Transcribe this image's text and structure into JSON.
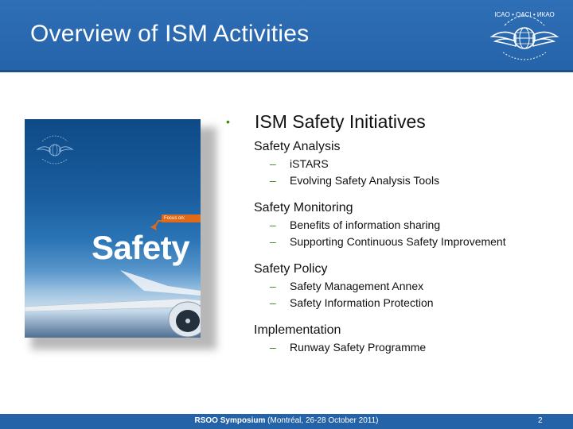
{
  "header": {
    "title": "Overview of ISM Activities",
    "logo_icon": "icao-emblem-icon",
    "logo_text": "ICAO • OACI • ИКАО"
  },
  "book_cover": {
    "tag": "Focus on:",
    "title": "Safety",
    "seal_icon": "icao-seal-icon",
    "image_icon": "airplane-icon"
  },
  "content": {
    "heading": "ISM Safety Initiatives",
    "groups": [
      {
        "title": "Safety Analysis",
        "items": [
          "iSTARS",
          "Evolving Safety Analysis Tools"
        ]
      },
      {
        "title": "Safety Monitoring",
        "items": [
          "Benefits of information sharing",
          "Supporting Continuous Safety Improvement"
        ]
      },
      {
        "title": "Safety Policy",
        "items": [
          "Safety Management Annex",
          "Safety Information Protection"
        ]
      },
      {
        "title": "Implementation",
        "items": [
          "Runway Safety Programme"
        ]
      }
    ]
  },
  "footer": {
    "event": "RSOO Symposium",
    "details": "(Montréal, 26-28 October 2011)",
    "page": "2"
  },
  "colors": {
    "header_blue": "#2f6fb6",
    "bullet_green": "#3a8a1c",
    "focus_orange": "#e06a17"
  }
}
